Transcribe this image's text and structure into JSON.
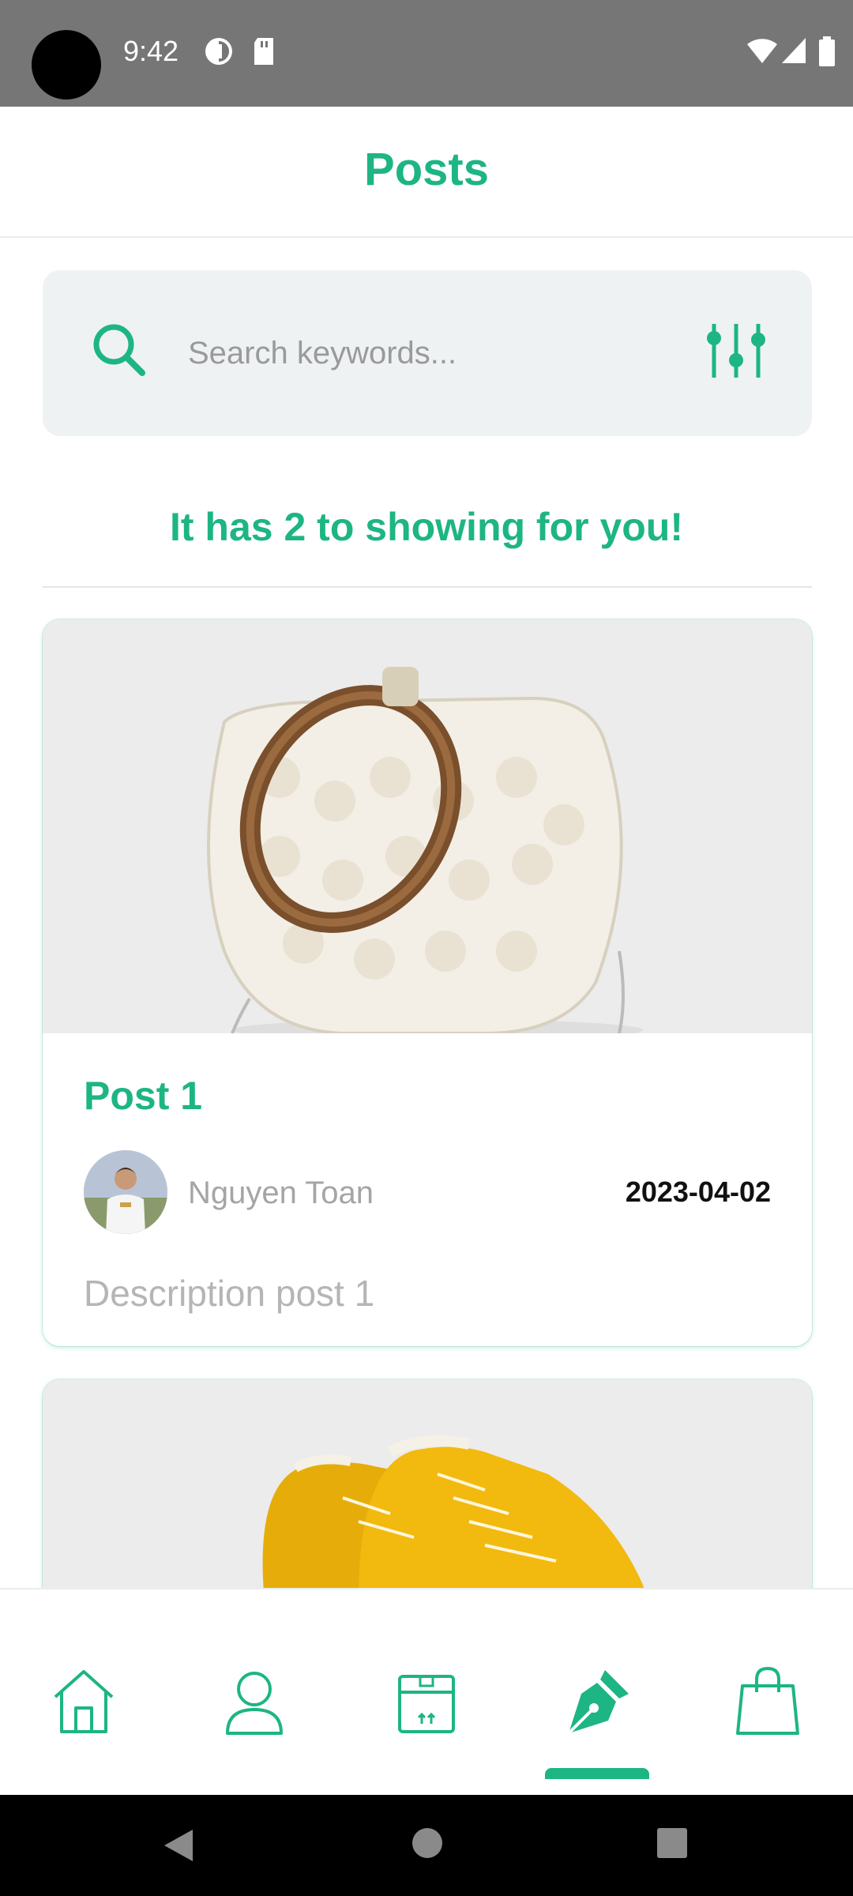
{
  "status_bar": {
    "time": "9:42",
    "icons": [
      "data-saver-icon",
      "sd-card-icon",
      "wifi-icon",
      "cell-signal-icon",
      "battery-icon"
    ]
  },
  "header": {
    "title": "Posts"
  },
  "search": {
    "placeholder": "Search keywords...",
    "icon": "search-icon",
    "filter_icon": "sliders-icon"
  },
  "results": {
    "text": "It has 2 to showing for you!"
  },
  "posts": [
    {
      "title": "Post 1",
      "author": "Nguyen Toan",
      "date": "2023-04-02",
      "description": "Description post 1",
      "image": "handbag-image"
    },
    {
      "title": "",
      "image": "sneakers-image"
    }
  ],
  "bottom_nav": {
    "items": [
      {
        "name": "home",
        "icon": "home-icon"
      },
      {
        "name": "profile",
        "icon": "user-icon"
      },
      {
        "name": "orders",
        "icon": "box-icon"
      },
      {
        "name": "posts",
        "icon": "pen-icon",
        "active": true
      },
      {
        "name": "shop",
        "icon": "shopping-bag-icon"
      }
    ]
  },
  "colors": {
    "accent": "#1db584",
    "status_bar": "#767676",
    "search_bg": "#eff2f3"
  }
}
